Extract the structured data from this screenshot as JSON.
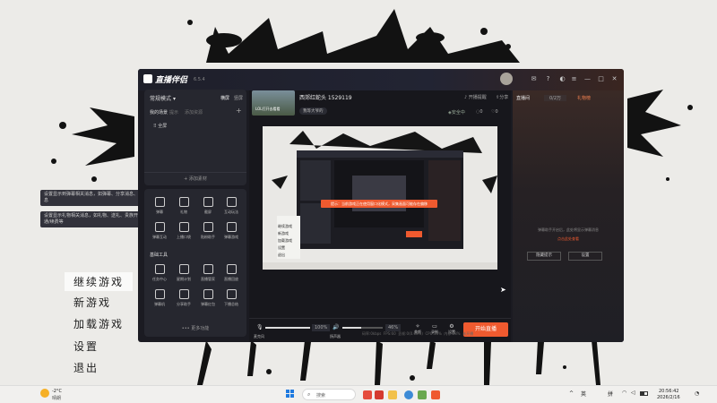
{
  "game_menu": {
    "items": [
      "继续游戏",
      "新游戏",
      "加载游戏",
      "设置",
      "退出"
    ],
    "tooltips": [
      "设置显示到弹幕相关消息，如弹幕、分享消息、粉丝牌升级等消息",
      "设置显示礼物相关消息，如礼物、送礼、贵族开通/续费、贴粉开通/续费等"
    ]
  },
  "app": {
    "name": "直播伴侣",
    "version": "6.5.4",
    "scene_mode": "常规模式",
    "orientation_tabs": [
      "横屏",
      "竖屏"
    ],
    "scene_tabs": [
      "我的场景",
      "提示",
      "添加资源"
    ],
    "scene_item": "全屏",
    "add_material": "+ 添加素材",
    "tools_row1": [
      "弹幕",
      "礼物",
      "截屏",
      "互动玩法"
    ],
    "tools_row2": [
      "弹幕互动",
      "上播口袋",
      "贴粉助手",
      "弹幕游戏"
    ],
    "tools_section_title": "基础工具",
    "tools_row3": [
      "任务中心",
      "星期计划",
      "直播管家",
      "直播回放"
    ],
    "tools_row4": [
      "弹幕机",
      "分享助手",
      "弹幕红包",
      "下播总结"
    ],
    "more_tools": "••• 更多功能",
    "room_thumb_text": "LOL打开去看看",
    "room_title": "西郊红蛇头 1529119",
    "room_sub": "我等大爷的",
    "header_actions": [
      "开播提醒",
      "分享"
    ],
    "stats": {
      "safe": "安全中",
      "viewers": "0",
      "likes": "0"
    },
    "preview_alert": "提示：当前游戏正在使用窗口化模式，采集画面可能存在偏移",
    "mini_menu": [
      "继续游戏",
      "新游戏",
      "加载游戏",
      "设置",
      "退出"
    ],
    "mic_label": "麦克风",
    "mic_value": "100%",
    "speaker_label": "扬声器",
    "speaker_value": "46%",
    "bottom_icons": [
      "美颜",
      "录制",
      "设置"
    ],
    "start_button": "开始直播",
    "status_bar": [
      "码率:0kbps",
      "FPS:60",
      "丢帧:0(0.00%)",
      "CPU:16%",
      "内存:28%",
      "未开播"
    ],
    "right_tabs": [
      "直播间",
      "0/2万",
      "礼物榜"
    ],
    "right_empty": "弹幕助手开启后，此处将显示弹幕消息",
    "right_link": "点击此处查看",
    "right_buttons": [
      "隐藏提示",
      "设置"
    ]
  },
  "taskbar": {
    "weather_temp": "-2°C",
    "weather_desc": "晴朗",
    "search_placeholder": "搜索",
    "lang1": "英",
    "lang2": "拼",
    "time": "20:56:42",
    "date": "2026/2/16"
  },
  "colors": {
    "accent": "#ef5a2f",
    "panel": "#26272f",
    "app_bg": "#1b1b22"
  }
}
